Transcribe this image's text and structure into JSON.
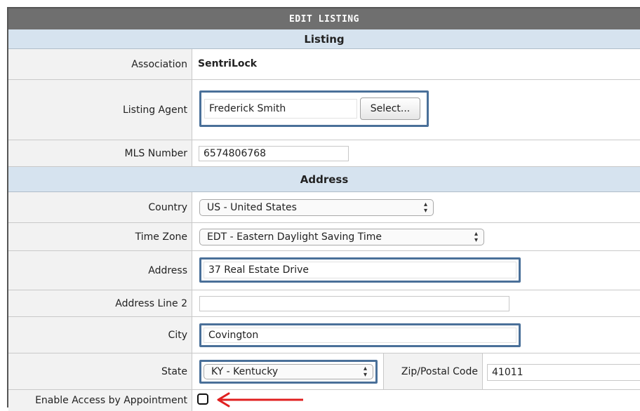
{
  "form": {
    "title": "EDIT LISTING",
    "sections": {
      "listing": "Listing",
      "address": "Address"
    },
    "association": {
      "label": "Association",
      "value": "SentriLock"
    },
    "listing_agent": {
      "label": "Listing Agent",
      "value": "Frederick Smith",
      "button": "Select..."
    },
    "mls_number": {
      "label": "MLS Number",
      "value": "6574806768"
    },
    "country": {
      "label": "Country",
      "value": "US - United States"
    },
    "time_zone": {
      "label": "Time Zone",
      "value": "EDT - Eastern Daylight Saving Time"
    },
    "address": {
      "label": "Address",
      "value": "37 Real Estate Drive"
    },
    "address_line_2": {
      "label": "Address Line 2",
      "value": ""
    },
    "city": {
      "label": "City",
      "value": "Covington"
    },
    "state": {
      "label": "State",
      "value": "KY - Kentucky"
    },
    "zip": {
      "label": "Zip/Postal Code",
      "value": "41011"
    },
    "enable_access": {
      "label": "Enable Access by Appointment",
      "checked": false
    }
  },
  "colors": {
    "title_bar": "#6f6f6f",
    "section_header": "#d6e3ef",
    "highlight_border": "#4a7099",
    "annotation_arrow": "#e02020"
  }
}
